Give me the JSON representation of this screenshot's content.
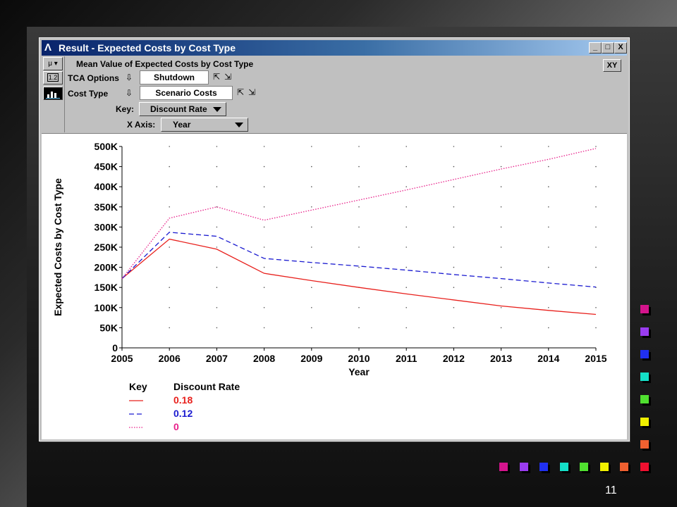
{
  "window": {
    "title": "Result - Expected Costs by Cost Type",
    "buttons": [
      "_",
      "□",
      "X"
    ]
  },
  "toolbar": {
    "mu_label": "μ ▾",
    "num_label": "1.2",
    "chart_icon": "bar-chart-icon"
  },
  "header": {
    "heading": "Mean Value of Expected Costs by Cost Type",
    "tca_label": "TCA Options",
    "tca_value": "Shutdown",
    "cost_type_label": "Cost Type",
    "cost_type_value": "Scenario Costs",
    "key_label": "Key:",
    "key_value": "Discount Rate",
    "xaxis_label": "X Axis:",
    "xaxis_value": "Year",
    "xy_button": "XY"
  },
  "legend": {
    "key_header": "Key",
    "rate_header": "Discount Rate"
  },
  "chart_data": {
    "type": "line",
    "ylabel": "Expected Costs by Cost Type",
    "xlabel": "Year",
    "x": [
      2005,
      2006,
      2007,
      2008,
      2009,
      2010,
      2011,
      2012,
      2013,
      2014,
      2015
    ],
    "xlim": [
      2005,
      2015
    ],
    "ylim": [
      0,
      500000
    ],
    "y_ticks": [
      "0",
      "50K",
      "100K",
      "150K",
      "200K",
      "250K",
      "300K",
      "350K",
      "400K",
      "450K",
      "500K"
    ],
    "grid": "dotted",
    "legend_position": "bottom-left",
    "series": [
      {
        "name": "0.18",
        "color": "#e8201c",
        "dash": "solid",
        "values": [
          172000,
          270000,
          245000,
          185000,
          167000,
          150000,
          134000,
          119000,
          104000,
          93000,
          83000
        ]
      },
      {
        "name": "0.12",
        "color": "#1a1ad0",
        "dash": "dashed",
        "values": [
          172000,
          287000,
          277000,
          222000,
          212000,
          203000,
          193000,
          182000,
          172000,
          161000,
          151000
        ]
      },
      {
        "name": "0",
        "color": "#e8208a",
        "dash": "dotted",
        "values": [
          172000,
          322000,
          350000,
          317000,
          342000,
          367000,
          392000,
          418000,
          444000,
          468000,
          495000
        ]
      }
    ]
  },
  "slide": {
    "number": "11",
    "squares_right": [
      "#d4148c",
      "#9a3cf0",
      "#2030f0",
      "#14e0c8",
      "#50e030",
      "#f0f000",
      "#f06030"
    ],
    "squares_bottom": [
      "#d4148c",
      "#9a3cf0",
      "#2030f0",
      "#14e0c8",
      "#50e030",
      "#f0f000",
      "#f06030",
      "#f01030"
    ]
  }
}
